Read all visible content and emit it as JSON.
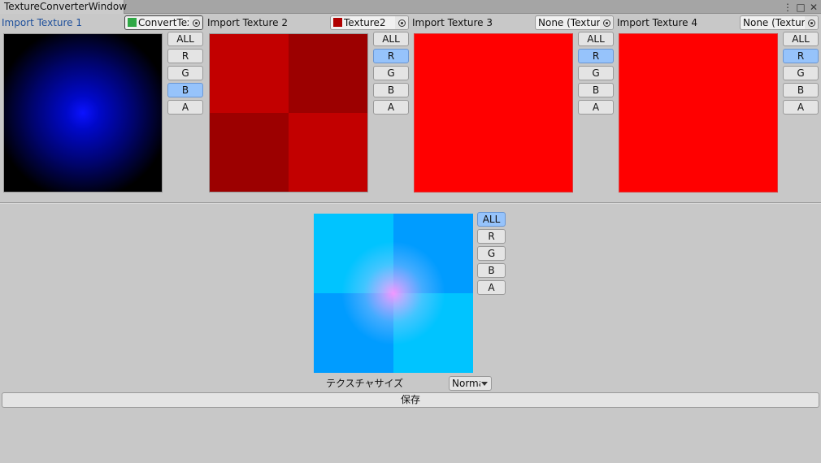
{
  "window": {
    "title": "TextureConverterWindow",
    "menu_icon": "more-vert-icon",
    "maximize_icon": "maximize-icon",
    "close_icon": "close-icon"
  },
  "imports": [
    {
      "label": "Import Texture 1",
      "field_value": "ConvertTex",
      "thumb_color": "#2fa845",
      "channels": [
        "ALL",
        "R",
        "G",
        "B",
        "A"
      ],
      "selected_channel": "B"
    },
    {
      "label": "Import Texture 2",
      "field_value": "Texture2",
      "thumb_color": "#b00000",
      "channels": [
        "ALL",
        "R",
        "G",
        "B",
        "A"
      ],
      "selected_channel": "R"
    },
    {
      "label": "Import Texture 3",
      "field_value": "None (Texture",
      "thumb_color": "",
      "channels": [
        "ALL",
        "R",
        "G",
        "B",
        "A"
      ],
      "selected_channel": "R"
    },
    {
      "label": "Import Texture 4",
      "field_value": "None (Texture",
      "thumb_color": "",
      "channels": [
        "ALL",
        "R",
        "G",
        "B",
        "A"
      ],
      "selected_channel": "R"
    }
  ],
  "output": {
    "channels": [
      "ALL",
      "R",
      "G",
      "B",
      "A"
    ],
    "selected_channel": "ALL",
    "size_label": "テクスチャサイズ",
    "size_value": "Normal",
    "save_label": "保存"
  },
  "colors": {
    "selected_button": "#96c3fb",
    "active_label": "#1d4f9b",
    "background": "#c8c8c8"
  }
}
